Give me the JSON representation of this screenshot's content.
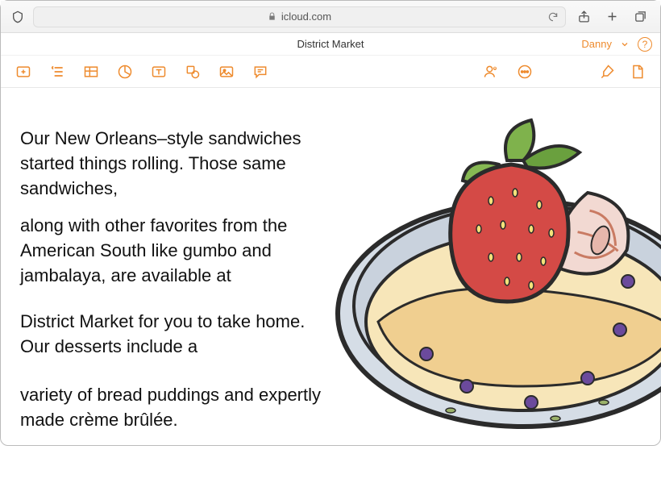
{
  "browser": {
    "url_display": "icloud.com"
  },
  "app": {
    "document_title": "District Market",
    "user_name": "Danny"
  },
  "toolbar": {
    "icons": [
      "add-icon",
      "paragraph-styles-icon",
      "table-icon",
      "chart-icon",
      "text-box-icon",
      "shape-icon",
      "media-icon",
      "comment-icon"
    ],
    "right_icons": [
      "collaborate-icon",
      "more-icon"
    ],
    "far_right_icons": [
      "format-brush-icon",
      "document-options-icon"
    ]
  },
  "document": {
    "p1": "Our New Orleans–style sandwiches started things rolling. Those same sandwiches,",
    "p2": "along with other favorites from the American South like gumbo and jambalaya, are available at",
    "p3": "District Market for you to take home. Our desserts include a",
    "p4": "variety of bread puddings and expertly made crème brûlée."
  },
  "colors": {
    "accent": "#EE8B2E"
  }
}
